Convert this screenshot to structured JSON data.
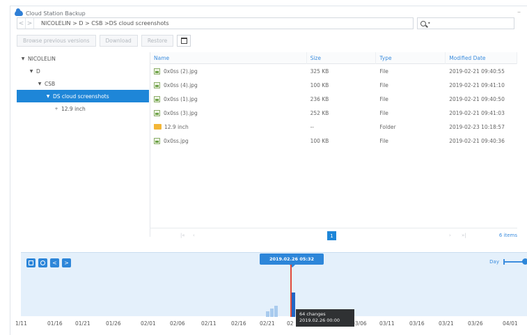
{
  "window": {
    "title": "Cloud Station Backup",
    "minimize": "–"
  },
  "address": {
    "back": "<",
    "forward": ">",
    "breadcrumb": "NICOLELIN > D > CSB >DS cloud screenshots",
    "search_placeholder": "•"
  },
  "toolbar": {
    "browse": "Browse previous versions",
    "download": "Download",
    "restore": "Restore"
  },
  "tree": [
    {
      "label": "NICOLELIN",
      "toggle": "▼",
      "depth": 0,
      "selected": false
    },
    {
      "label": "D",
      "toggle": "▼",
      "depth": 1,
      "selected": false
    },
    {
      "label": "CSB",
      "toggle": "▼",
      "depth": 2,
      "selected": false
    },
    {
      "label": "DS cloud screenshots",
      "toggle": "▼",
      "depth": 3,
      "selected": true
    },
    {
      "label": "12.9 inch",
      "toggle": "+",
      "depth": 4,
      "selected": false
    }
  ],
  "table": {
    "headers": {
      "name": "Name",
      "size": "Size",
      "type": "Type",
      "modified": "Modified Date"
    },
    "rows": [
      {
        "name": "0x0ss (2).jpg",
        "size": "325 KB",
        "type": "File",
        "modified": "2019-02-21 09:40:55",
        "icon": "image-file-icon"
      },
      {
        "name": "0x0ss (4).jpg",
        "size": "100 KB",
        "type": "File",
        "modified": "2019-02-21 09:41:10",
        "icon": "image-file-icon"
      },
      {
        "name": "0x0ss (1).jpg",
        "size": "236 KB",
        "type": "File",
        "modified": "2019-02-21 09:40:50",
        "icon": "image-file-icon"
      },
      {
        "name": "0x0ss (3).jpg",
        "size": "252 KB",
        "type": "File",
        "modified": "2019-02-21 09:41:03",
        "icon": "image-file-icon"
      },
      {
        "name": "12.9 inch",
        "size": "--",
        "type": "Folder",
        "modified": "2019-02-23 10:18:57",
        "icon": "folder-icon"
      },
      {
        "name": "0x0ss.jpg",
        "size": "100 KB",
        "type": "File",
        "modified": "2019-02-21 09:40:36",
        "icon": "image-file-icon"
      }
    ]
  },
  "pager": {
    "first": "|«",
    "prev": "‹",
    "current": "1",
    "next": "›",
    "last": "»|",
    "count": "6 items"
  },
  "timeline": {
    "prev": "<",
    "next": ">",
    "selected_stamp": "2019.02.26 05:32",
    "tooltip_line1": "64 changes",
    "tooltip_line2": "2019.02.26 00:00",
    "zoom_label": "Day",
    "axis": [
      "1/11",
      "01/16",
      "01/21",
      "01/26",
      "02/01",
      "02/06",
      "02/11",
      "02/16",
      "02/21",
      "02",
      "03/06",
      "03/11",
      "03/16",
      "03/21",
      "03/26",
      "04/01"
    ],
    "colors": {
      "accent": "#2d86d9",
      "marker": "#e04a3a",
      "panel": "#e4f0fb"
    }
  }
}
